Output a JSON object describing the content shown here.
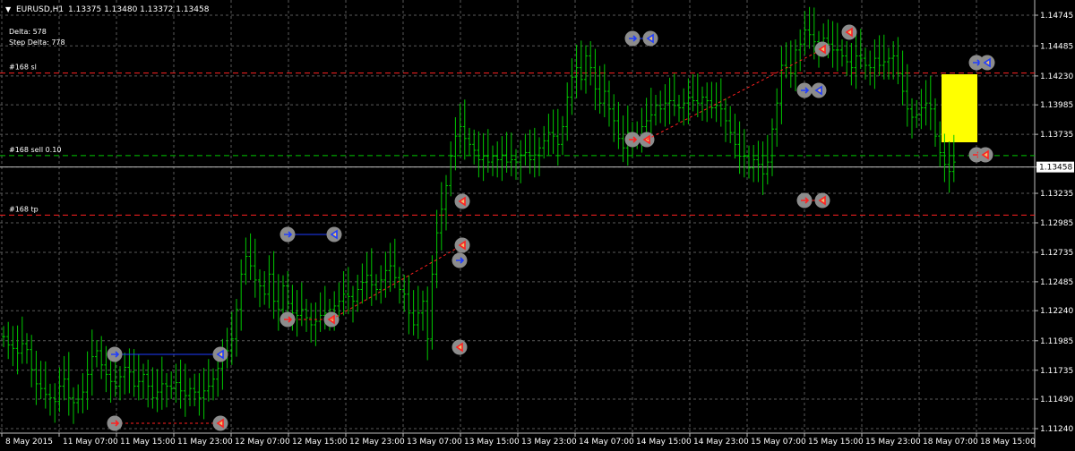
{
  "header": {
    "menu_icon": "triangle-down-icon",
    "symbol_label": "EURUSD,H1",
    "ohlc": "1.13375 1.13480 1.13372 1.13458",
    "delta": "Delta: 578",
    "step_delta": "Step Delta: 778"
  },
  "colors": {
    "background": "#000000",
    "grid": "#5a5a5a",
    "bars": "#00c800",
    "price_line": "#c0c0c0",
    "sl_line": "#ff2020",
    "tp_line": "#ff2020",
    "entry_line": "#00c800",
    "price_label_bg": "#ffffff",
    "price_label_fg": "#000000",
    "highlight": "#ffff00",
    "trade_buy": "#1e3cff",
    "trade_sell": "#ff2020",
    "marker_circle": "#8c8c8c"
  },
  "chart_data": {
    "type": "ohlc",
    "symbol": "EURUSD",
    "timeframe": "H1",
    "y_ticks": [
      "1.14745",
      "1.14485",
      "1.14230",
      "1.13985",
      "1.13735",
      "1.13458",
      "1.13235",
      "1.12985",
      "1.12735",
      "1.12485",
      "1.12240",
      "1.11985",
      "1.11735",
      "1.11490",
      "1.11240"
    ],
    "y_range": [
      1.1115,
      1.1485
    ],
    "x_ticks": [
      "8 May 2015",
      "11 May 07:00",
      "11 May 15:00",
      "11 May 23:00",
      "12 May 07:00",
      "12 May 15:00",
      "12 May 23:00",
      "13 May 07:00",
      "13 May 15:00",
      "13 May 23:00",
      "14 May 07:00",
      "14 May 15:00",
      "14 May 23:00",
      "15 May 07:00",
      "15 May 15:00",
      "15 May 23:00",
      "18 May 07:00",
      "18 May 15:00"
    ],
    "current_price": "1.13458",
    "grid": true,
    "levels": [
      {
        "label": "#168 sl",
        "price": 1.14255,
        "style": "dashed"
      },
      {
        "label": "#168 sell 0.10",
        "price": 1.13555,
        "style": "dashed"
      },
      {
        "label": "#168 tp",
        "price": 1.1305,
        "style": "dashed"
      }
    ],
    "bars_approx_close": [
      1.1202,
      1.1195,
      1.1192,
      1.1188,
      1.1196,
      1.1191,
      1.1174,
      1.1162,
      1.1158,
      1.1153,
      1.115,
      1.1147,
      1.116,
      1.1166,
      1.115,
      1.1146,
      1.1149,
      1.1155,
      1.117,
      1.1185,
      1.119,
      1.1178,
      1.117,
      1.1164,
      1.116,
      1.1168,
      1.1176,
      1.1172,
      1.116,
      1.1164,
      1.117,
      1.116,
      1.115,
      1.1155,
      1.1162,
      1.116,
      1.1158,
      1.1163,
      1.1156,
      1.1152,
      1.1158,
      1.1155,
      1.115,
      1.1156,
      1.116,
      1.1166,
      1.1175,
      1.1184,
      1.119,
      1.12,
      1.1225,
      1.1255,
      1.127,
      1.1262,
      1.125,
      1.1245,
      1.1238,
      1.1255,
      1.1232,
      1.1225,
      1.1245,
      1.123,
      1.1222,
      1.122,
      1.1225,
      1.1218,
      1.1212,
      1.1215,
      1.122,
      1.1222,
      1.1225,
      1.1228,
      1.1232,
      1.1238,
      1.1236,
      1.1232,
      1.1242,
      1.1248,
      1.1254,
      1.1246,
      1.1242,
      1.125,
      1.1258,
      1.1262,
      1.1252,
      1.1242,
      1.1238,
      1.1222,
      1.1212,
      1.1222,
      1.1232,
      1.12,
      1.1255,
      1.129,
      1.131,
      1.133,
      1.1355,
      1.1372,
      1.138,
      1.137,
      1.1365,
      1.136,
      1.1352,
      1.1355,
      1.135,
      1.1355,
      1.1352,
      1.1356,
      1.135,
      1.1352,
      1.135,
      1.1356,
      1.1358,
      1.1352,
      1.1356,
      1.1362,
      1.1368,
      1.1375,
      1.1372,
      1.1365,
      1.138,
      1.1405,
      1.1422,
      1.143,
      1.142,
      1.144,
      1.143,
      1.1412,
      1.14,
      1.141,
      1.1395,
      1.1385,
      1.137,
      1.1362,
      1.1375,
      1.1372,
      1.137,
      1.138,
      1.1385,
      1.139,
      1.1398,
      1.1395,
      1.14,
      1.1402,
      1.1398,
      1.1396,
      1.14,
      1.1405,
      1.1402,
      1.14,
      1.1405,
      1.1402,
      1.1396,
      1.1398,
      1.1395,
      1.1385,
      1.1375,
      1.1365,
      1.1355,
      1.1355,
      1.1345,
      1.1352,
      1.1348,
      1.134,
      1.135,
      1.1378,
      1.14,
      1.1432,
      1.143,
      1.1425,
      1.1445,
      1.145,
      1.1462,
      1.1458,
      1.1452,
      1.1448,
      1.1455,
      1.145,
      1.1445,
      1.1445,
      1.144,
      1.1435,
      1.143,
      1.144,
      1.1438,
      1.1432,
      1.143,
      1.1438,
      1.1432,
      1.1435,
      1.1438,
      1.144,
      1.1425,
      1.141,
      1.1395,
      1.1388,
      1.139,
      1.1396,
      1.14,
      1.1395,
      1.1372,
      1.1358,
      1.1348,
      1.1342,
      1.135
    ]
  }
}
